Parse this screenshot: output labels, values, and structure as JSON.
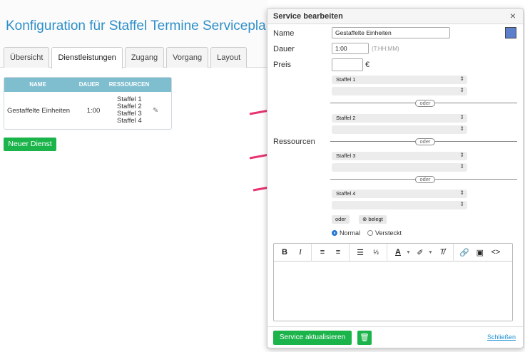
{
  "page": {
    "title": "Konfiguration für Staffel Termine Serviceplan",
    "tabs": [
      "Übersicht",
      "Dienstleistungen",
      "Zugang",
      "Vorgang",
      "Layout"
    ],
    "active_tab": "Dienstleistungen",
    "table": {
      "headers": [
        "NAME",
        "DAUER",
        "RESSOURCEN"
      ],
      "rows": [
        {
          "name": "Gestaffelte Einheiten",
          "duration": "1:00",
          "resources": [
            "Staffel 1",
            "Staffel 2",
            "Staffel 3",
            "Staffel 4"
          ],
          "edit_icon": "pencil-icon"
        }
      ]
    },
    "new_service_label": "Neuer Dienst"
  },
  "modal": {
    "title": "Service bearbeiten",
    "close_glyph": "×",
    "name_label": "Name",
    "name_value": "Gestaffelte Einheiten",
    "color": "#5b7fcb",
    "duration_label": "Dauer",
    "duration_value": "1:00",
    "duration_hint": "(T:HH:MM)",
    "price_label": "Preis",
    "price_value": "",
    "currency": "€",
    "resources_label": "Ressourcen",
    "resource_groups": [
      {
        "selected": "Staffel 1",
        "second": ""
      },
      {
        "selected": "Staffel 2",
        "second": ""
      },
      {
        "selected": "Staffel 3",
        "second": ""
      },
      {
        "selected": "Staffel 4",
        "second": ""
      }
    ],
    "or_label": "oder",
    "or_chip": "oder",
    "occupied_chip": "⊗ belegt",
    "visibility_options": [
      {
        "label": "Normal",
        "selected": true
      },
      {
        "label": "Versteckt",
        "selected": false
      }
    ],
    "editor_content": "",
    "update_button": "Service aktualisieren",
    "trash_icon": "trash-icon",
    "close_link": "Schließen"
  },
  "colors": {
    "accent": "#2e8fc8",
    "green": "#1bb44b",
    "arrow": "#e8336f",
    "table_header": "#7fbecf"
  }
}
